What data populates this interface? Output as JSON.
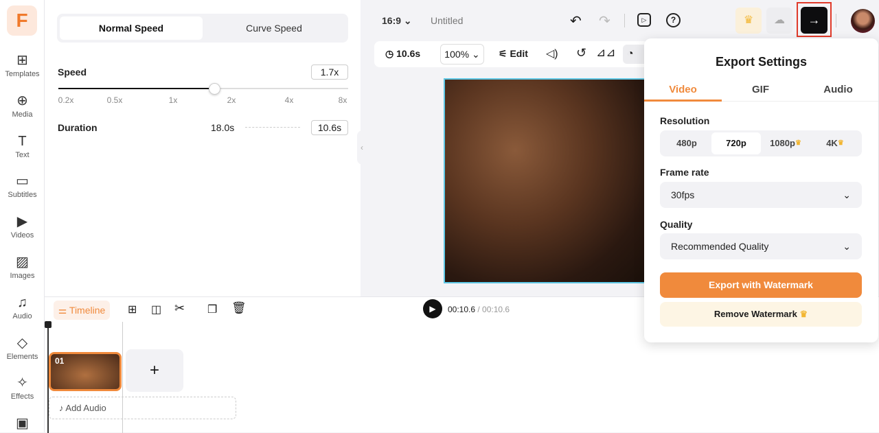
{
  "sidebar": {
    "logo": "F",
    "items": [
      {
        "label": "Templates",
        "icon": "templates-icon",
        "glyph": "⊞"
      },
      {
        "label": "Media",
        "icon": "media-icon",
        "glyph": "⊕"
      },
      {
        "label": "Text",
        "icon": "text-icon",
        "glyph": "T"
      },
      {
        "label": "Subtitles",
        "icon": "subtitles-icon",
        "glyph": "▭"
      },
      {
        "label": "Videos",
        "icon": "videos-icon",
        "glyph": "▶"
      },
      {
        "label": "Images",
        "icon": "images-icon",
        "glyph": "▨"
      },
      {
        "label": "Audio",
        "icon": "audio-icon",
        "glyph": "♫"
      },
      {
        "label": "Elements",
        "icon": "elements-icon",
        "glyph": "◇"
      },
      {
        "label": "Effects",
        "icon": "effects-icon",
        "glyph": "✧"
      },
      {
        "label": "",
        "icon": "toolbox-icon",
        "glyph": "▣"
      }
    ]
  },
  "speed_panel": {
    "tabs": [
      "Normal Speed",
      "Curve Speed"
    ],
    "active_tab": "Normal Speed",
    "speed_label": "Speed",
    "speed_value": "1.7x",
    "ticks": [
      "0.2x",
      "0.5x",
      "1x",
      "2x",
      "4x",
      "8x"
    ],
    "slider_fraction": 0.54,
    "duration_label": "Duration",
    "duration_original": "18.0s",
    "duration_new": "10.6s"
  },
  "topbar": {
    "aspect": "16:9",
    "title": "Untitled"
  },
  "toolbar": {
    "duration": "10.6s",
    "zoom": "100%",
    "edit": "Edit"
  },
  "timeline": {
    "label": "Timeline",
    "current": "00:10.6",
    "total": "/ 00:10.6",
    "clip_number": "01",
    "add_audio": "Add Audio",
    "add_clip": "+"
  },
  "export": {
    "title": "Export Settings",
    "tabs": [
      "Video",
      "GIF",
      "Audio"
    ],
    "active_tab": "Video",
    "resolution_label": "Resolution",
    "resolutions": [
      "480p",
      "720p",
      "1080p",
      "4K"
    ],
    "selected_resolution": "720p",
    "framerate_label": "Frame rate",
    "framerate": "30fps",
    "quality_label": "Quality",
    "quality": "Recommended Quality",
    "export_button": "Export with Watermark",
    "remove_watermark": "Remove Watermark"
  },
  "colors": {
    "accent": "#f08a3c",
    "highlight_border": "#e03a2a"
  }
}
